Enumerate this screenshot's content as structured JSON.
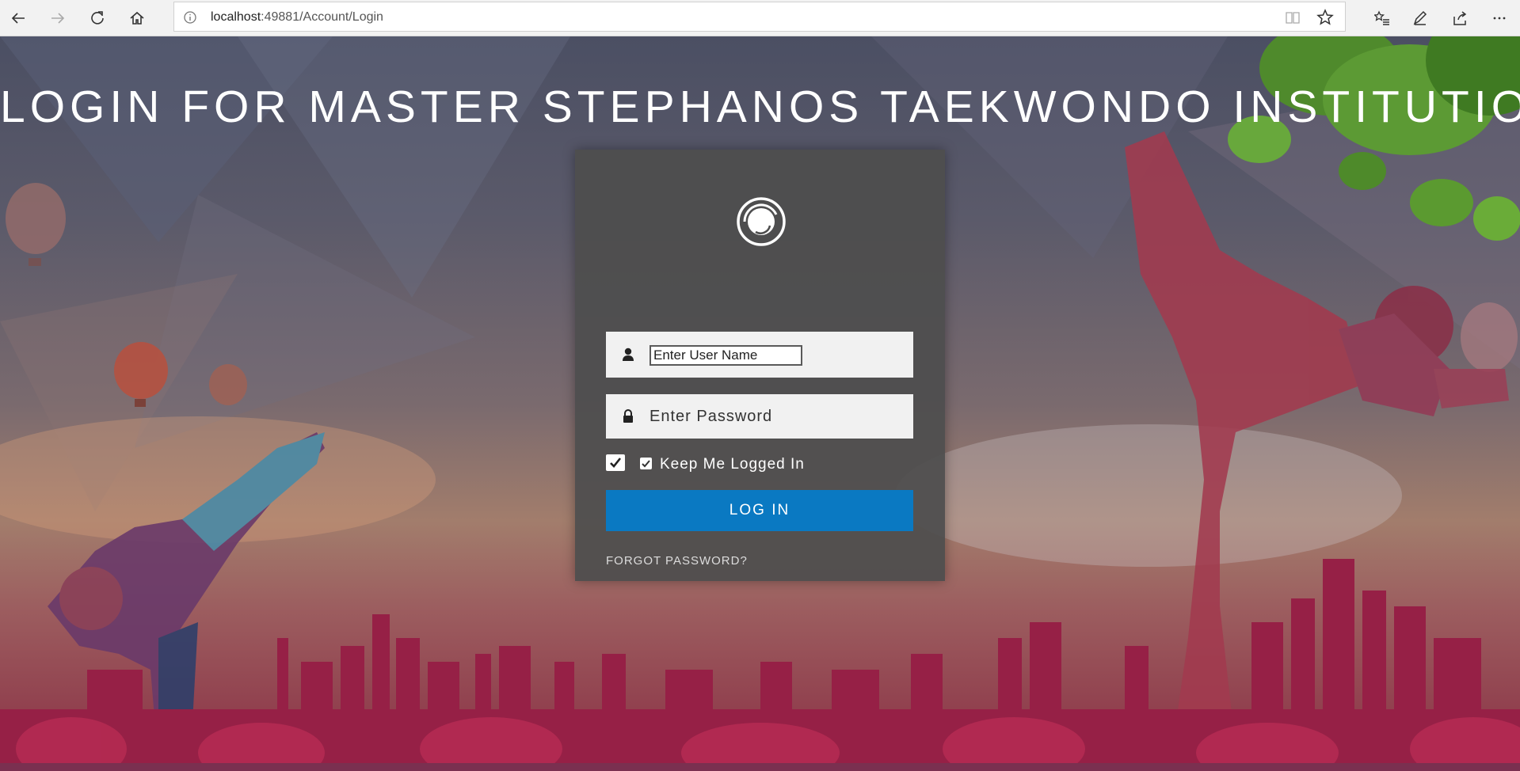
{
  "browser": {
    "url_host": "localhost",
    "url_rest": ":49881/Account/Login",
    "icons": [
      "back-icon",
      "forward-icon",
      "refresh-icon",
      "home-icon",
      "info-icon",
      "reading-view-icon",
      "favorite-star-icon",
      "favorites-list-icon",
      "pen-icon",
      "share-icon",
      "more-icon"
    ]
  },
  "page": {
    "title": "LOGIN FOR MASTER STEPHANOS TAEKWONDO INSTITUTION"
  },
  "login": {
    "username_placeholder": "Enter User Name",
    "password_placeholder": "Enter Password",
    "keep_logged_in_label": "Keep Me Logged In",
    "keep_logged_in_checked": true,
    "login_button": "LOG IN",
    "forgot_password": "FORGOT PASSWORD?",
    "button_color": "#0a79c2"
  }
}
